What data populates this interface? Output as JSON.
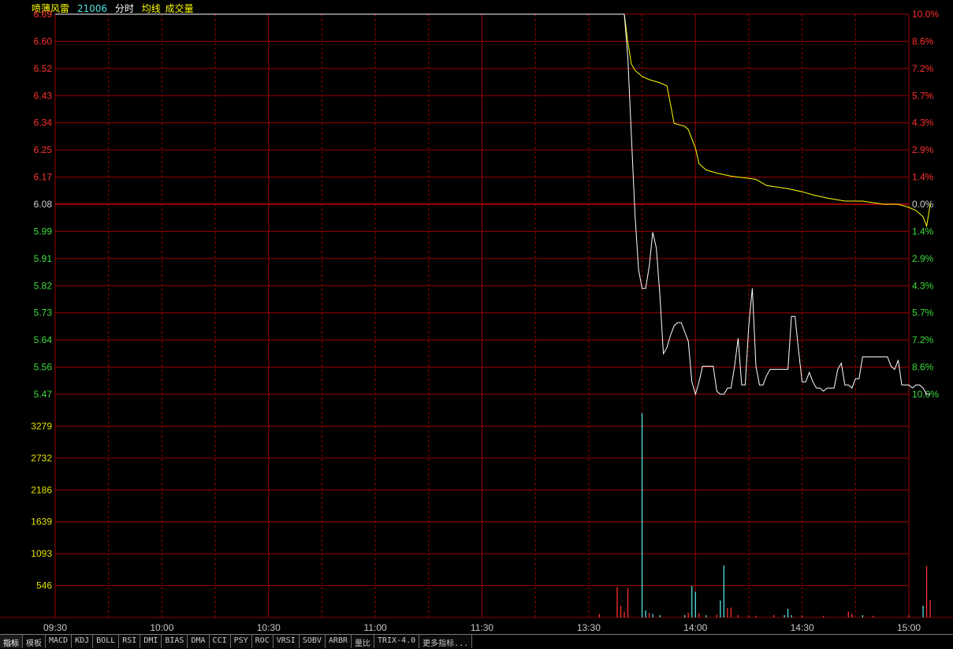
{
  "header": {
    "stock_name": "喷薄风雷",
    "code": "21006",
    "mode_label": "分时",
    "avg_label": "均线",
    "vol_label": "成交量"
  },
  "colors": {
    "up": "#ff3030",
    "down": "#3cdc3c",
    "flat": "#d0d0d0",
    "grid": "#9c0000",
    "price_line": "#ffffff",
    "avg_line": "#ffff00",
    "vol_axis": "#e0e000",
    "time": "#c8c8c8",
    "vol_bar_cyan": "#50e0e0"
  },
  "price_axis": {
    "left_labels": [
      "6.69",
      "6.60",
      "6.52",
      "6.43",
      "6.34",
      "6.25",
      "6.17",
      "6.08",
      "5.99",
      "5.91",
      "5.82",
      "5.73",
      "5.64",
      "5.56",
      "5.47"
    ],
    "right_labels": [
      "10.0%",
      "8.6%",
      "7.2%",
      "5.7%",
      "4.3%",
      "2.9%",
      "1.4%",
      "0.0%",
      "1.4%",
      "2.9%",
      "4.3%",
      "5.7%",
      "7.2%",
      "8.6%",
      "10.0%"
    ],
    "max": 6.69,
    "min": 5.47
  },
  "volume_axis": {
    "labels": [
      "3279",
      "2732",
      "2186",
      "1639",
      "1093",
      "546"
    ],
    "max": 3825
  },
  "time_axis": {
    "labels": [
      "09:30",
      "10:00",
      "10:30",
      "11:00",
      "11:30",
      "13:30",
      "14:00",
      "14:30",
      "15:00"
    ]
  },
  "tabs": [
    {
      "label": "指标",
      "active": true
    },
    {
      "label": "模板",
      "active": false
    },
    {
      "label": "MACD",
      "active": false
    },
    {
      "label": "KDJ",
      "active": false
    },
    {
      "label": "BOLL",
      "active": false
    },
    {
      "label": "RSI",
      "active": false
    },
    {
      "label": "DMI",
      "active": false
    },
    {
      "label": "BIAS",
      "active": false
    },
    {
      "label": "DMA",
      "active": false
    },
    {
      "label": "CCI",
      "active": false
    },
    {
      "label": "PSY",
      "active": false
    },
    {
      "label": "ROC",
      "active": false
    },
    {
      "label": "VRSI",
      "active": false
    },
    {
      "label": "SOBV",
      "active": false
    },
    {
      "label": "ARBR",
      "active": false
    },
    {
      "label": "量比",
      "active": false
    },
    {
      "label": "TRIX-4.0",
      "active": false
    },
    {
      "label": "更多指标...",
      "active": false
    }
  ],
  "chart_data": {
    "type": "line",
    "x_labels": [
      "09:30",
      "10:00",
      "10:30",
      "11:00",
      "11:30",
      "13:30",
      "14:00",
      "14:30",
      "15:00"
    ],
    "series": [
      {
        "name": "分时",
        "points": [
          [
            0,
            6.69
          ],
          [
            160,
            6.69
          ],
          [
            161,
            6.55
          ],
          [
            162,
            6.3
          ],
          [
            163,
            6.05
          ],
          [
            164,
            5.87
          ],
          [
            165,
            5.81
          ],
          [
            166,
            5.81
          ],
          [
            167,
            5.88
          ],
          [
            168,
            5.99
          ],
          [
            169,
            5.94
          ],
          [
            170,
            5.79
          ],
          [
            171,
            5.6
          ],
          [
            172,
            5.62
          ],
          [
            173,
            5.66
          ],
          [
            174,
            5.69
          ],
          [
            175,
            5.7
          ],
          [
            176,
            5.7
          ],
          [
            177,
            5.67
          ],
          [
            178,
            5.64
          ],
          [
            179,
            5.51
          ],
          [
            180,
            5.47
          ],
          [
            181,
            5.51
          ],
          [
            182,
            5.56
          ],
          [
            183,
            5.56
          ],
          [
            184,
            5.56
          ],
          [
            185,
            5.56
          ],
          [
            186,
            5.48
          ],
          [
            187,
            5.47
          ],
          [
            188,
            5.47
          ],
          [
            189,
            5.49
          ],
          [
            190,
            5.49
          ],
          [
            191,
            5.56
          ],
          [
            192,
            5.65
          ],
          [
            193,
            5.5
          ],
          [
            194,
            5.5
          ],
          [
            195,
            5.69
          ],
          [
            196,
            5.81
          ],
          [
            197,
            5.56
          ],
          [
            198,
            5.5
          ],
          [
            199,
            5.5
          ],
          [
            200,
            5.53
          ],
          [
            201,
            5.55
          ],
          [
            202,
            5.55
          ],
          [
            203,
            5.55
          ],
          [
            204,
            5.55
          ],
          [
            205,
            5.55
          ],
          [
            206,
            5.55
          ],
          [
            207,
            5.72
          ],
          [
            208,
            5.72
          ],
          [
            209,
            5.61
          ],
          [
            210,
            5.51
          ],
          [
            211,
            5.51
          ],
          [
            212,
            5.54
          ],
          [
            213,
            5.51
          ],
          [
            214,
            5.49
          ],
          [
            215,
            5.49
          ],
          [
            216,
            5.48
          ],
          [
            217,
            5.49
          ],
          [
            218,
            5.49
          ],
          [
            219,
            5.49
          ],
          [
            220,
            5.55
          ],
          [
            221,
            5.57
          ],
          [
            222,
            5.5
          ],
          [
            223,
            5.5
          ],
          [
            224,
            5.49
          ],
          [
            225,
            5.52
          ],
          [
            226,
            5.52
          ],
          [
            227,
            5.59
          ],
          [
            228,
            5.59
          ],
          [
            229,
            5.59
          ],
          [
            230,
            5.59
          ],
          [
            231,
            5.59
          ],
          [
            232,
            5.59
          ],
          [
            233,
            5.59
          ],
          [
            234,
            5.59
          ],
          [
            235,
            5.56
          ],
          [
            236,
            5.55
          ],
          [
            237,
            5.58
          ],
          [
            238,
            5.5
          ],
          [
            239,
            5.5
          ],
          [
            240,
            5.5
          ],
          [
            241,
            5.49
          ],
          [
            242,
            5.5
          ],
          [
            243,
            5.5
          ],
          [
            244,
            5.49
          ],
          [
            245,
            5.47
          ],
          [
            246,
            5.47
          ]
        ]
      },
      {
        "name": "均线",
        "points": [
          [
            0,
            6.69
          ],
          [
            160,
            6.69
          ],
          [
            161,
            6.6
          ],
          [
            162,
            6.53
          ],
          [
            163,
            6.51
          ],
          [
            165,
            6.49
          ],
          [
            167,
            6.48
          ],
          [
            170,
            6.47
          ],
          [
            172,
            6.46
          ],
          [
            173,
            6.4
          ],
          [
            174,
            6.34
          ],
          [
            177,
            6.33
          ],
          [
            178,
            6.32
          ],
          [
            180,
            6.26
          ],
          [
            181,
            6.21
          ],
          [
            183,
            6.19
          ],
          [
            186,
            6.18
          ],
          [
            190,
            6.17
          ],
          [
            197,
            6.16
          ],
          [
            200,
            6.14
          ],
          [
            206,
            6.13
          ],
          [
            210,
            6.12
          ],
          [
            213,
            6.11
          ],
          [
            217,
            6.1
          ],
          [
            222,
            6.09
          ],
          [
            227,
            6.09
          ],
          [
            233,
            6.08
          ],
          [
            237,
            6.08
          ],
          [
            240,
            6.07
          ],
          [
            242,
            6.06
          ],
          [
            244,
            6.04
          ],
          [
            245,
            6.01
          ],
          [
            246,
            6.08
          ]
        ]
      }
    ],
    "volume_bars": [
      {
        "x": 153,
        "v": 60,
        "c": "up"
      },
      {
        "x": 158,
        "v": 520,
        "c": "up"
      },
      {
        "x": 159,
        "v": 200,
        "c": "up"
      },
      {
        "x": 160,
        "v": 100,
        "c": "up"
      },
      {
        "x": 161,
        "v": 500,
        "c": "up"
      },
      {
        "x": 165,
        "v": 3500,
        "c": "cyan"
      },
      {
        "x": 166,
        "v": 120,
        "c": "cyan"
      },
      {
        "x": 167,
        "v": 80,
        "c": "up"
      },
      {
        "x": 168,
        "v": 60,
        "c": "cyan"
      },
      {
        "x": 170,
        "v": 40,
        "c": "cyan"
      },
      {
        "x": 177,
        "v": 40,
        "c": "cyan"
      },
      {
        "x": 178,
        "v": 80,
        "c": "up"
      },
      {
        "x": 179,
        "v": 540,
        "c": "cyan"
      },
      {
        "x": 180,
        "v": 440,
        "c": "cyan"
      },
      {
        "x": 181,
        "v": 70,
        "c": "up"
      },
      {
        "x": 183,
        "v": 40,
        "c": "cyan"
      },
      {
        "x": 186,
        "v": 50,
        "c": "up"
      },
      {
        "x": 187,
        "v": 290,
        "c": "cyan"
      },
      {
        "x": 188,
        "v": 890,
        "c": "cyan"
      },
      {
        "x": 189,
        "v": 160,
        "c": "up"
      },
      {
        "x": 190,
        "v": 170,
        "c": "up"
      },
      {
        "x": 192,
        "v": 40,
        "c": "up"
      },
      {
        "x": 195,
        "v": 30,
        "c": "up"
      },
      {
        "x": 197,
        "v": 30,
        "c": "up"
      },
      {
        "x": 202,
        "v": 40,
        "c": "up"
      },
      {
        "x": 205,
        "v": 40,
        "c": "cyan"
      },
      {
        "x": 206,
        "v": 150,
        "c": "cyan"
      },
      {
        "x": 207,
        "v": 40,
        "c": "cyan"
      },
      {
        "x": 210,
        "v": 30,
        "c": "up"
      },
      {
        "x": 216,
        "v": 30,
        "c": "up"
      },
      {
        "x": 223,
        "v": 100,
        "c": "up"
      },
      {
        "x": 224,
        "v": 60,
        "c": "up"
      },
      {
        "x": 227,
        "v": 40,
        "c": "cyan"
      },
      {
        "x": 230,
        "v": 30,
        "c": "up"
      },
      {
        "x": 240,
        "v": 40,
        "c": "up"
      },
      {
        "x": 244,
        "v": 200,
        "c": "cyan"
      },
      {
        "x": 245,
        "v": 880,
        "c": "up"
      },
      {
        "x": 246,
        "v": 300,
        "c": "up"
      }
    ],
    "x_range": [
      0,
      240
    ],
    "ylim": [
      5.47,
      6.69
    ]
  }
}
